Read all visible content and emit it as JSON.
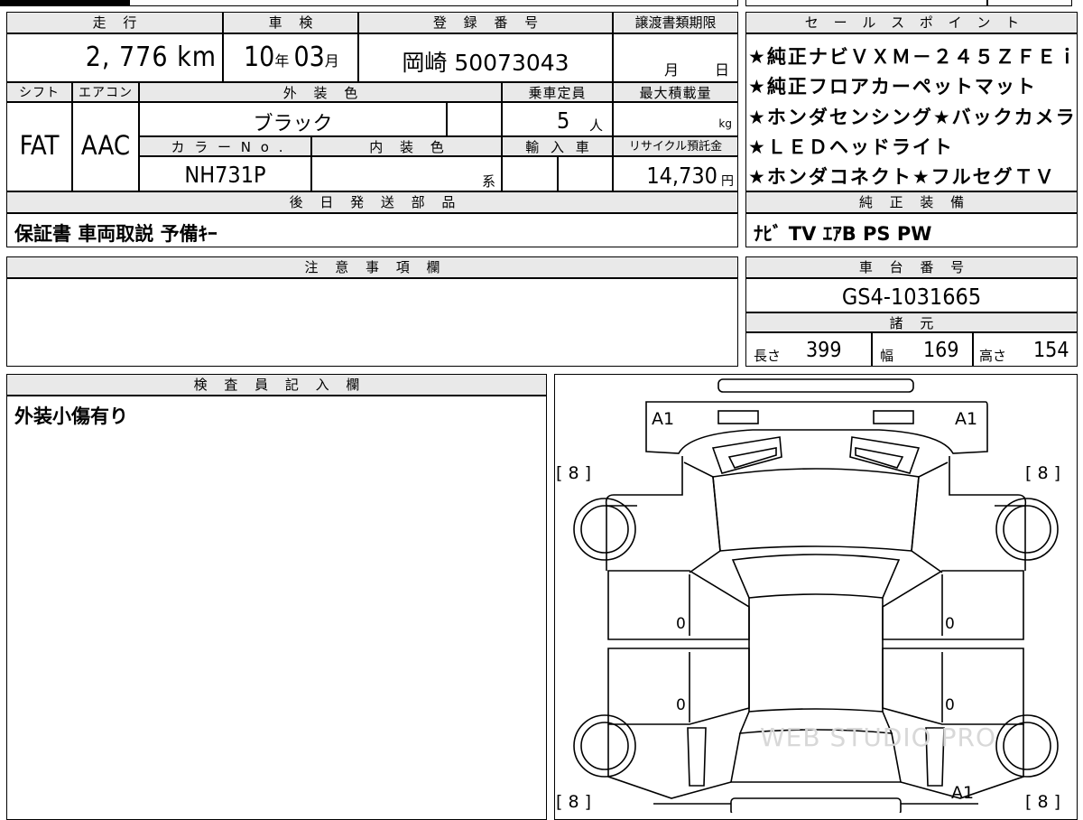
{
  "headers": {
    "mileage": "走 行",
    "inspection": "車 検",
    "registration": "登 録 番 号",
    "transfer_deadline": "譲渡書類期限",
    "sales_points": "セ ー ル ス ポ イ ン ト",
    "shift": "シフト",
    "aircon": "エアコン",
    "exterior_color": "外 装 色",
    "capacity": "乗車定員",
    "max_load": "最大積載量",
    "color_no": "カ ラ ー N o .",
    "interior_color": "内 装 色",
    "import": "輸 入 車",
    "recycle": "リサイクル預託金",
    "later_parts": "後 日 発 送 部 品",
    "genuine_equipment": "純 正 装 備",
    "notes": "注 意 事 項 欄",
    "chassis_no": "車 台 番 号",
    "specs": "諸 元",
    "inspector": "検 査 員 記 入 欄"
  },
  "vehicle": {
    "mileage_value": "2, 776 km",
    "inspection_year": "10",
    "inspection_year_unit": "年",
    "inspection_month": "03",
    "inspection_month_unit": "月",
    "registration_no": "岡崎 50073043",
    "deadline_month_unit": "月",
    "deadline_day_unit": "日",
    "shift": "FAT",
    "aircon": "AAC",
    "exterior_color": "ブラック",
    "capacity": "5",
    "capacity_unit": "人",
    "max_load_unit": "kg",
    "color_no": "NH731P",
    "interior_color_suffix": "系",
    "recycle_fee": "14,730",
    "recycle_unit": "円",
    "later_parts": "保証書 車両取説 予備ｷｰ",
    "genuine_equipment": "ﾅﾋﾞ TV ｴｱB PS PW",
    "chassis_no": "GS4-1031665",
    "length_label": "長さ",
    "length": "399",
    "width_label": "幅",
    "width": "169",
    "height_label": "高さ",
    "height": "154",
    "inspector_note": "外装小傷有り"
  },
  "sales_points": [
    "★純正ナビＶＸＭ－２４５ＺＦＥｉ",
    "★純正フロアカーペットマット",
    "★ホンダセンシング★バックカメラ",
    "★ＬＥＤヘッドライト",
    "★ホンダコネクト★フルセグＴＶ"
  ],
  "diagram": {
    "front_left": "A1",
    "front_right": "A1",
    "tire_fl": "[ 8 ]",
    "tire_fr": "[ 8 ]",
    "tire_rl": "[ 8 ]",
    "tire_rr": "[ 8 ]",
    "door_fl": "0",
    "door_fr": "0",
    "door_rl": "0",
    "door_rr": "0",
    "rear_right": "A1",
    "watermark": "WEB STUDIO PRO"
  }
}
